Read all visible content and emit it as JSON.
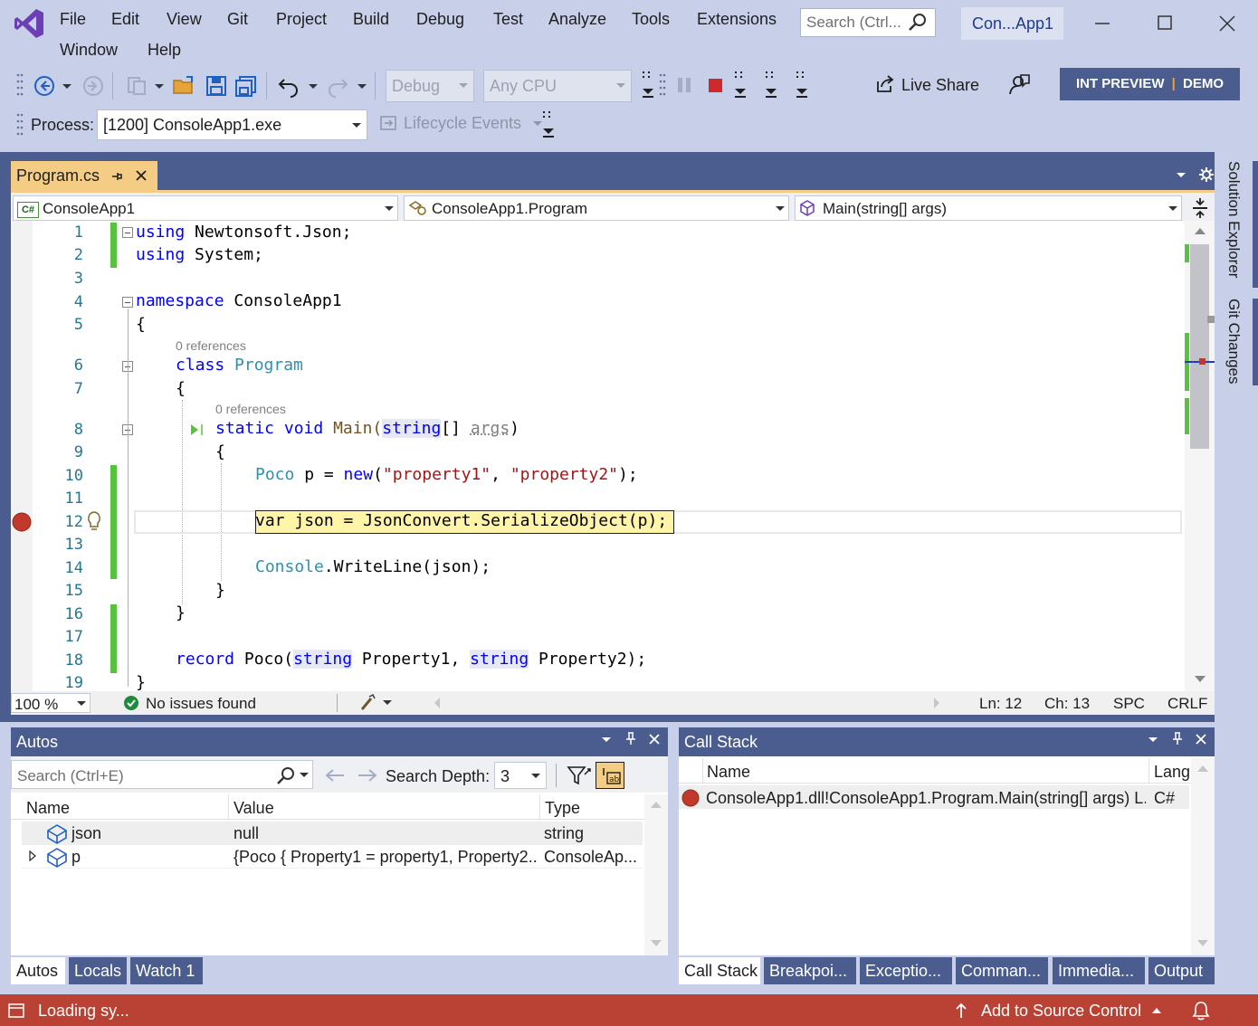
{
  "window": {
    "solution_name": "Con...App1",
    "search_placeholder": "Search (Ctrl..."
  },
  "menu": [
    "File",
    "Edit",
    "View",
    "Git",
    "Project",
    "Build",
    "Debug",
    "Test",
    "Analyze",
    "Tools",
    "Extensions",
    "Window",
    "Help"
  ],
  "toolbar": {
    "config": "Debug",
    "platform": "Any CPU",
    "live_share": "Live Share",
    "int_preview": "INT PREVIEW",
    "demo": "DEMO",
    "process_label": "Process:",
    "process_value": "[1200] ConsoleApp1.exe",
    "lifecycle": "Lifecycle Events"
  },
  "editor": {
    "tab_name": "Program.cs",
    "nav_project": "ConsoleApp1",
    "nav_project_badge": "C#",
    "nav_class": "ConsoleApp1.Program",
    "nav_member": "Main(string[] args)",
    "refs_label": "0 references",
    "zoom": "100 %",
    "issues": "No issues found",
    "ln": "Ln: 12",
    "ch": "Ch: 13",
    "spc": "SPC",
    "crlf": "CRLF",
    "lines": [
      "1",
      "2",
      "3",
      "4",
      "5",
      "6",
      "7",
      "8",
      "9",
      "10",
      "11",
      "12",
      "13",
      "14",
      "15",
      "16",
      "17",
      "18",
      "19"
    ],
    "code": {
      "l1_kw": "using",
      "l1_rest": " Newtonsoft.Json;",
      "l2_kw": "using",
      "l2_rest": " System;",
      "l4_kw": "namespace",
      "l4_rest": " ConsoleApp1",
      "brace_open": "{",
      "brace_close": "}",
      "l6_kw": "class",
      "l6_ty": "Program",
      "l8_kw1": "static",
      "l8_kw2": "void",
      "l8_name": "Main(",
      "l8_ty": "string",
      "l8_mid": "[] ",
      "l8_pm": "args",
      "l8_end": ")",
      "l10_ty": "Poco",
      "l10_a": " p = ",
      "l10_kw": "new",
      "l10_b": "(",
      "l10_s1": "\"property1\"",
      "l10_c": ", ",
      "l10_s2": "\"property2\"",
      "l10_d": ");",
      "l12_kw": "var",
      "l12_rest": " json = JsonConvert.SerializeObject(p);",
      "l14_ty": "Console",
      "l14_rest": ".WriteLine(json);",
      "l18_kw": "record",
      "l18_a": " Poco(",
      "l18_ty1": "string",
      "l18_b": " Property1, ",
      "l18_ty2": "string",
      "l18_c": " Property2);"
    }
  },
  "sidebar": {
    "solution_explorer": "Solution Explorer",
    "git_changes": "Git Changes"
  },
  "autos": {
    "title": "Autos",
    "search_placeholder": "Search (Ctrl+E)",
    "search_depth_label": "Search Depth:",
    "search_depth": "3",
    "columns": [
      "Name",
      "Value",
      "Type"
    ],
    "rows": [
      {
        "name": "json",
        "value": "null",
        "type": "string"
      },
      {
        "name": "p",
        "value": "{Poco { Property1 = property1, Property2...",
        "type": "ConsoleAp..."
      }
    ],
    "tabs": [
      "Autos",
      "Locals",
      "Watch 1"
    ]
  },
  "callstack": {
    "title": "Call Stack",
    "columns": [
      "Name",
      "Lang"
    ],
    "rows": [
      {
        "name": "ConsoleApp1.dll!ConsoleApp1.Program.Main(string[] args) L...",
        "lang": "C#"
      }
    ],
    "tabs": [
      "Call Stack",
      "Breakpoi...",
      "Exceptio...",
      "Comman...",
      "Immedia...",
      "Output"
    ]
  },
  "statusbar": {
    "loading": "Loading sy...",
    "source_control": "Add to Source Control"
  },
  "colors": {
    "accent": "#4a5d8e",
    "chrome": "#c7d0e8",
    "tab_active": "#f5cc84",
    "status": "#b94235",
    "breakpoint": "#c0392b"
  }
}
